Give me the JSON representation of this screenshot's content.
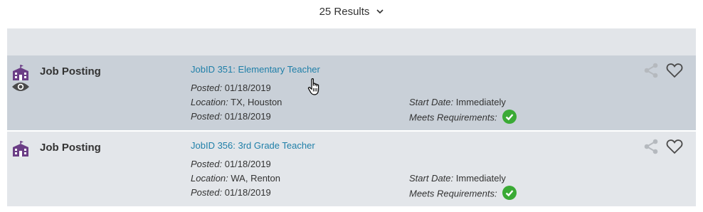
{
  "results": {
    "label": "25 Results",
    "chevron": "chevron-down-icon"
  },
  "colors": {
    "link": "#1f7fa8",
    "icon_purple": "#6b3e86",
    "check_green": "#3aaa35",
    "row_bg": "#e3e6ea",
    "row_hover_bg": "#c9d0d8"
  },
  "postings": [
    {
      "type": "Job Posting",
      "title": "JobID 351: Elementary Teacher",
      "posted_label": "Posted:",
      "posted": "01/18/2019",
      "location_label": "Location:",
      "location": "TX, Houston",
      "posted2_label": "Posted:",
      "posted2": "01/18/2019",
      "start_label": "Start Date:",
      "start": "Immediately",
      "meets_label": "Meets Requirements:",
      "viewed": true
    },
    {
      "type": "Job Posting",
      "title": "JobID 356: 3rd Grade Teacher",
      "posted_label": "Posted:",
      "posted": "01/18/2019",
      "location_label": "Location:",
      "location": "WA, Renton",
      "posted2_label": "Posted:",
      "posted2": "01/18/2019",
      "start_label": "Start Date:",
      "start": "Immediately",
      "meets_label": "Meets Requirements:",
      "viewed": false
    }
  ]
}
